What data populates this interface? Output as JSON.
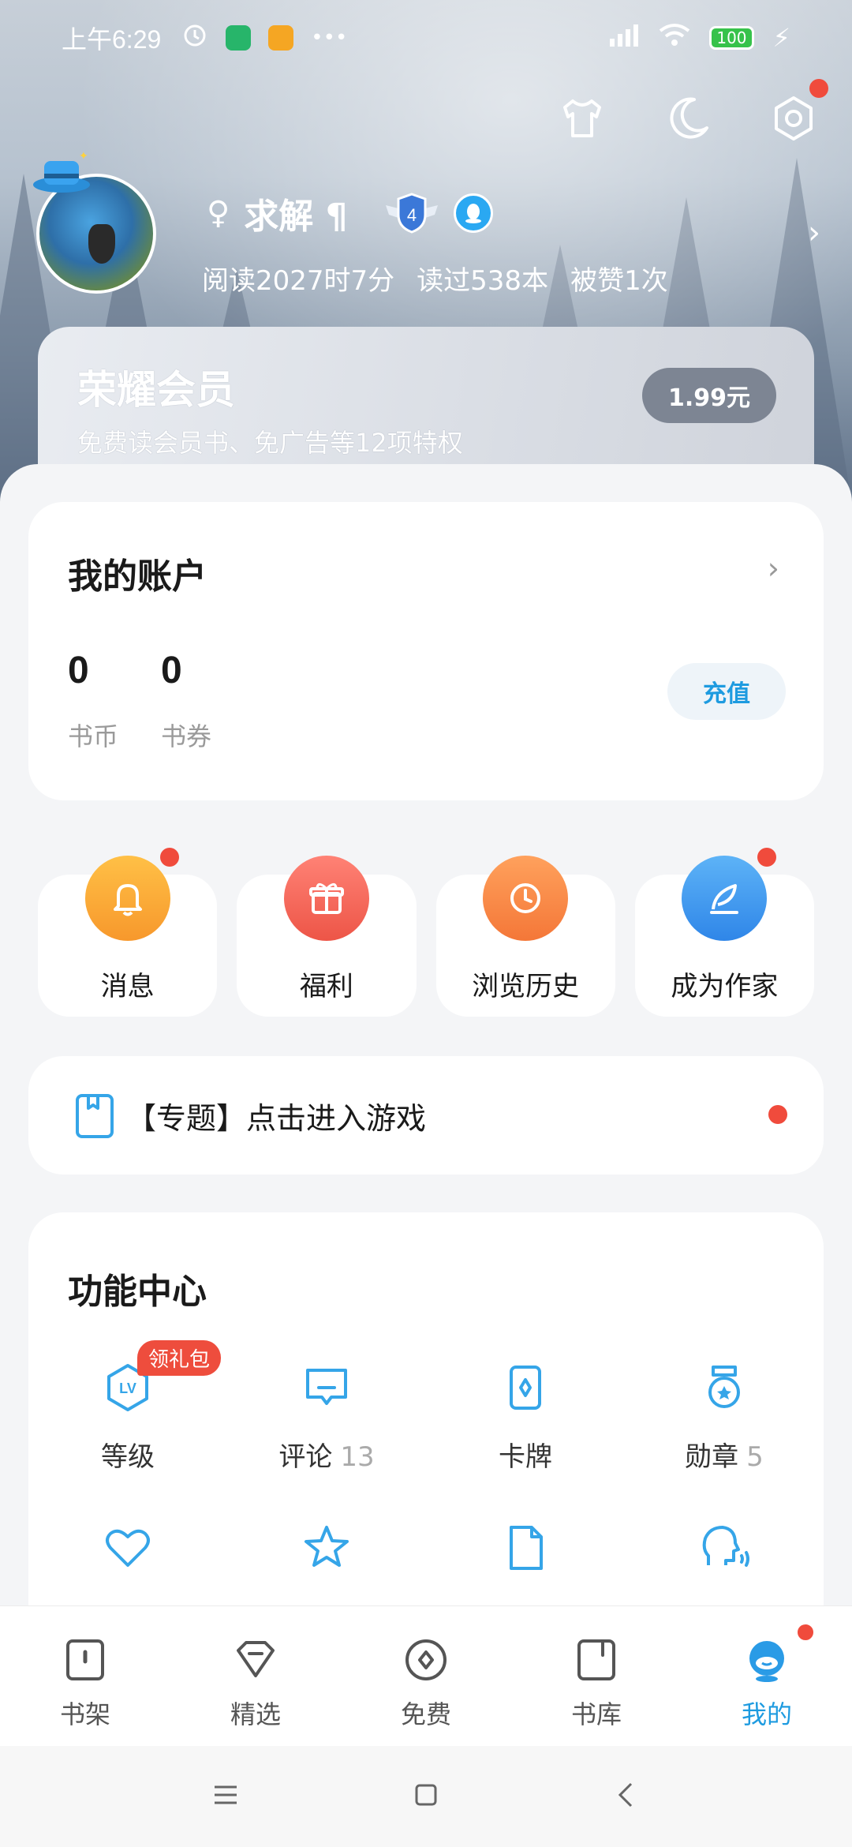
{
  "status_bar": {
    "time": "上午6:29",
    "battery": "100"
  },
  "profile": {
    "gender_symbol": "♀",
    "name": "求解 ¶",
    "level_badge": "4",
    "stats": [
      "阅读2027时7分",
      "读过538本",
      "被赞1次"
    ]
  },
  "vip": {
    "title": "荣耀会员",
    "subtitle": "免费读会员书、免广告等12项特权",
    "price": "1.99元"
  },
  "account": {
    "title": "我的账户",
    "coins_value": "0",
    "coins_label": "书币",
    "vouchers_value": "0",
    "vouchers_label": "书券",
    "recharge_label": "充值"
  },
  "quick_actions": [
    {
      "label": "消息",
      "icon": "bell-icon",
      "color": "#f9a93a"
    },
    {
      "label": "福利",
      "icon": "gift-icon",
      "color": "#f06a5d"
    },
    {
      "label": "浏览历史",
      "icon": "clock-icon",
      "color": "#f78a4a"
    },
    {
      "label": "成为作家",
      "icon": "quill-icon",
      "color": "#3d9bef"
    }
  ],
  "topic": {
    "label": "【专题】点击进入游戏"
  },
  "functions": {
    "title": "功能中心",
    "gift_tag": "领礼包",
    "items": [
      {
        "label": "等级",
        "count": ""
      },
      {
        "label": "评论",
        "count": "13"
      },
      {
        "label": "卡牌",
        "count": ""
      },
      {
        "label": "勋章",
        "count": "5"
      }
    ]
  },
  "bottom_nav": [
    {
      "label": "书架"
    },
    {
      "label": "精选"
    },
    {
      "label": "免费"
    },
    {
      "label": "书库"
    },
    {
      "label": "我的"
    }
  ],
  "colors": {
    "accent": "#1e9be0",
    "red_dot": "#f04b3c"
  }
}
